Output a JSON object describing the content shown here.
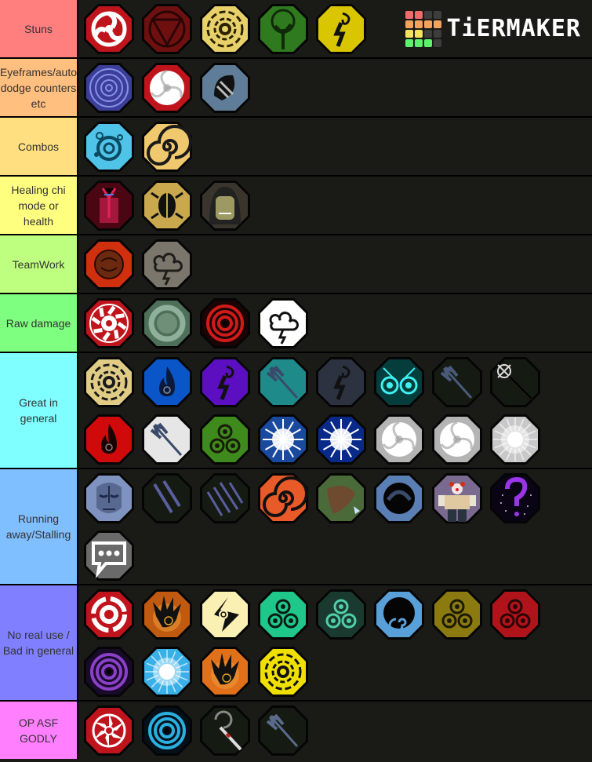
{
  "brand": {
    "name": "TiERMAKER",
    "grid_colors": [
      "#f26b6b",
      "#f26b6b",
      "#3d3d3d",
      "#3d3d3d",
      "#f5a25d",
      "#f5a25d",
      "#f5a25d",
      "#f5a25d",
      "#f5e35d",
      "#f5e35d",
      "#3d3d3d",
      "#3d3d3d",
      "#5df26b",
      "#5df26b",
      "#5df26b",
      "#3d3d3d"
    ]
  },
  "tiers": [
    {
      "label": "Stuns",
      "color": "#ff7f7f",
      "rows": 1,
      "items": [
        {
          "icon": "red-three-tomoe-icon",
          "bg": "#c0141c",
          "fg": "#ffffff",
          "shape": "tomoe"
        },
        {
          "icon": "dark-red-triangle-circle-icon",
          "bg": "#6e1010",
          "fg": "#2a0505",
          "shape": "triangle"
        },
        {
          "icon": "yellow-sun-wheel-icon",
          "bg": "#e8d16a",
          "fg": "#2a2200",
          "shape": "wheel"
        },
        {
          "icon": "green-tree-icon",
          "bg": "#2f7a1f",
          "fg": "#0f2a08",
          "shape": "tree"
        },
        {
          "icon": "yellow-lightning-spiral-icon",
          "bg": "#d9c600",
          "fg": "#111111",
          "shape": "bolt"
        }
      ]
    },
    {
      "label": "Eyeframes/auto dodge counters etc",
      "color": "#ffbf7f",
      "rows": 1,
      "items": [
        {
          "icon": "blue-vortex-icon",
          "bg": "#3b3f9a",
          "fg": "#8a90e8",
          "shape": "vortex"
        },
        {
          "icon": "red-white-pinwheel-icon",
          "bg": "#c0141c",
          "fg": "#ffffff",
          "shape": "pinwheel"
        },
        {
          "icon": "slate-striped-shell-icon",
          "bg": "#5f7d98",
          "fg": "#111111",
          "shape": "shell"
        }
      ]
    },
    {
      "label": "Combos",
      "color": "#ffdf7f",
      "rows": 1,
      "items": [
        {
          "icon": "cyan-water-swirl-icon",
          "bg": "#4fc3e8",
          "fg": "#0b4a60",
          "shape": "swirls"
        },
        {
          "icon": "tan-spiral-icon",
          "bg": "#f0c86e",
          "fg": "#1a1a1a",
          "shape": "spiral"
        }
      ]
    },
    {
      "label": "Healing chi mode or health",
      "color": "#ffff7f",
      "rows": 1,
      "items": [
        {
          "icon": "crimson-dragon-avatar-icon",
          "bg": "#4a0612",
          "fg": "#e0245a",
          "shape": "dragon"
        },
        {
          "icon": "gold-beetle-icon",
          "bg": "#c9a84e",
          "fg": "#111111",
          "shape": "beetle"
        },
        {
          "icon": "hooded-face-icon",
          "bg": "#3a352c",
          "fg": "#9c9a62",
          "shape": "hood"
        }
      ]
    },
    {
      "label": "TeamWork",
      "color": "#bfff7f",
      "rows": 1,
      "items": [
        {
          "icon": "red-rune-seal-icon",
          "bg": "#d0300e",
          "fg": "#6b2a10",
          "shape": "seal"
        },
        {
          "icon": "grey-wind-cloud-icon",
          "bg": "#7a766c",
          "fg": "#1f1d1a",
          "shape": "cloud"
        }
      ]
    },
    {
      "label": "Raw damage",
      "color": "#7fff7f",
      "rows": 1,
      "items": [
        {
          "icon": "red-white-sun-icon",
          "bg": "#c0141c",
          "fg": "#ffffff",
          "shape": "sun"
        },
        {
          "icon": "green-dragon-ring-icon",
          "bg": "#4e6f58",
          "fg": "#8fb09a",
          "shape": "ring"
        },
        {
          "icon": "red-black-rings-icon",
          "bg": "#1a0404",
          "fg": "#d11a1a",
          "shape": "rings"
        },
        {
          "icon": "white-storm-cloud-icon",
          "bg": "#ffffff",
          "fg": "#111111",
          "shape": "cloud"
        }
      ]
    },
    {
      "label": "Great in general",
      "color": "#7fffff",
      "rows": 2,
      "items": [
        {
          "icon": "pale-gold-wheel-icon",
          "bg": "#e0cc84",
          "fg": "#1a1a1a",
          "shape": "wheel"
        },
        {
          "icon": "blue-flame-icon",
          "bg": "#0a56c8",
          "fg": "#0a1a3a",
          "shape": "flame"
        },
        {
          "icon": "purple-lightning-spiral-icon",
          "bg": "#5b0fc0",
          "fg": "#111111",
          "shape": "bolt"
        },
        {
          "icon": "teal-trident-burst-icon",
          "bg": "#1f8a8a",
          "fg": "#3a4a6a",
          "shape": "trident"
        },
        {
          "icon": "dark-slate-lightning-icon",
          "bg": "#2c3240",
          "fg": "#111111",
          "shape": "bolt"
        },
        {
          "icon": "cyan-twin-eyes-icon",
          "bg": "#053d3d",
          "fg": "#3ff0f0",
          "shape": "eyes"
        },
        {
          "icon": "dark-trident-icon",
          "bg": "#151a12",
          "fg": "#4a5a7a",
          "shape": "trident"
        },
        {
          "icon": "crosshair-staff-icon",
          "bg": "#151a12",
          "fg": "#dddddd",
          "shape": "crosshair"
        },
        {
          "icon": "red-flame-icon",
          "bg": "#d00a0a",
          "fg": "#1a0202",
          "shape": "flame"
        },
        {
          "icon": "white-trident-icon",
          "bg": "#e6e6e6",
          "fg": "#3a4a6a",
          "shape": "trident"
        },
        {
          "icon": "green-triple-spiral-icon",
          "bg": "#3f8a1c",
          "fg": "#1a1a0a",
          "shape": "triskelion"
        },
        {
          "icon": "blue-white-burst-icon",
          "bg": "#1a4aa0",
          "fg": "#ffffff",
          "shape": "burst"
        },
        {
          "icon": "navy-lightning-orb-icon",
          "bg": "#0a2a8a",
          "fg": "#ffffff",
          "shape": "burst"
        },
        {
          "icon": "silver-pinwheel-icon",
          "bg": "#b4b4b4",
          "fg": "#ffffff",
          "shape": "pinwheel"
        },
        {
          "icon": "silver-pinwheel-icon-2",
          "bg": "#b4b4b4",
          "fg": "#ffffff",
          "shape": "pinwheel"
        },
        {
          "icon": "white-glow-orb-icon",
          "bg": "#c8c8c8",
          "fg": "#ffffff",
          "shape": "orb"
        }
      ]
    },
    {
      "label": "Running away/Stalling",
      "color": "#7fbfff",
      "rows": 2,
      "items": [
        {
          "icon": "blue-oni-mask-icon",
          "bg": "#7f93c0",
          "fg": "#1f2a4a",
          "shape": "mask"
        },
        {
          "icon": "two-slash-lines-icon",
          "bg": "#151a12",
          "fg": "#5a5e9e",
          "shape": "slash2"
        },
        {
          "icon": "four-slash-lines-icon",
          "bg": "#151a12",
          "fg": "#5a5e9e",
          "shape": "slash4"
        },
        {
          "icon": "orange-spiral-icon",
          "bg": "#e85a28",
          "fg": "#111111",
          "shape": "spiral"
        },
        {
          "icon": "brown-hawk-icon",
          "bg": "#4a6a3a",
          "fg": "#6e4a2e",
          "shape": "hawk"
        },
        {
          "icon": "blue-dark-arc-icon",
          "bg": "#5a7fb4",
          "fg": "#050505",
          "shape": "arc"
        },
        {
          "icon": "clown-avatar-icon",
          "bg": "#7a6a90",
          "fg": "#e0c8a0",
          "shape": "clown"
        },
        {
          "icon": "purple-question-mark-icon",
          "bg": "#0a0515",
          "fg": "#9a35e8",
          "shape": "question"
        },
        {
          "icon": "chat-bubble-icon",
          "bg": "#6a6a6a",
          "fg": "#ffffff",
          "shape": "chat"
        }
      ]
    },
    {
      "label": "No real use / Bad in general",
      "color": "#7f7fff",
      "rows": 2,
      "items": [
        {
          "icon": "red-white-target-icon",
          "bg": "#c0141c",
          "fg": "#ffffff",
          "shape": "target"
        },
        {
          "icon": "orange-burst-hand-icon",
          "bg": "#c05a10",
          "fg": "#111111",
          "shape": "hand"
        },
        {
          "icon": "cream-arrow-spiral-icon",
          "bg": "#fbf0b4",
          "fg": "#111111",
          "shape": "arrowspiral"
        },
        {
          "icon": "green-triple-spiral-icon-2",
          "bg": "#1fc88a",
          "fg": "#0a1a12",
          "shape": "triskelion"
        },
        {
          "icon": "white-mist-triskelion-icon",
          "bg": "#1a3a30",
          "fg": "#4fd0a8",
          "shape": "triskelion"
        },
        {
          "icon": "blue-black-hole-icon",
          "bg": "#5aa0d8",
          "fg": "#050505",
          "shape": "hole"
        },
        {
          "icon": "olive-triple-spiral-icon",
          "bg": "#8a7a10",
          "fg": "#1a1a05",
          "shape": "triskelion"
        },
        {
          "icon": "red-triple-spiral-icon",
          "bg": "#b0141a",
          "fg": "#2a0505",
          "shape": "triskelion"
        },
        {
          "icon": "purple-vortex-rings-icon",
          "bg": "#1a0a2a",
          "fg": "#8a40c8",
          "shape": "rings"
        },
        {
          "icon": "cyan-light-burst-icon",
          "bg": "#3ab0e8",
          "fg": "#ffffff",
          "shape": "orb"
        },
        {
          "icon": "orange-burst-hand-icon-2",
          "bg": "#e0701a",
          "fg": "#111111",
          "shape": "hand"
        },
        {
          "icon": "yellow-black-wheel-icon",
          "bg": "#f0e000",
          "fg": "#111111",
          "shape": "wheel"
        }
      ]
    },
    {
      "label": "OP ASF GODLY",
      "color": "#ff7fff",
      "rows": 1,
      "items": [
        {
          "icon": "red-six-blade-star-icon",
          "bg": "#c0141c",
          "fg": "#ffffff",
          "shape": "star6"
        },
        {
          "icon": "cyan-vortex-rings-icon",
          "bg": "#05101a",
          "fg": "#2ab0e0",
          "shape": "rings"
        },
        {
          "icon": "crescent-blade-staff-icon",
          "bg": "#151a12",
          "fg": "#888888",
          "shape": "staff"
        },
        {
          "icon": "twin-tridents-icon",
          "bg": "#151a12",
          "fg": "#5a6a8a",
          "shape": "trident"
        }
      ]
    }
  ]
}
